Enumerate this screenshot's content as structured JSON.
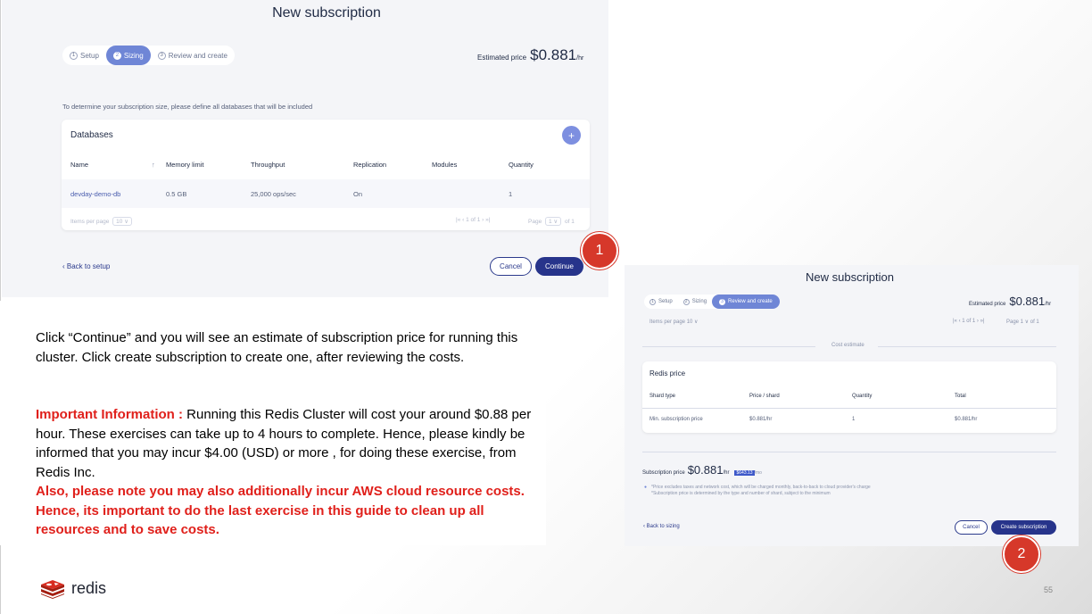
{
  "shot1": {
    "title": "New subscription",
    "steps": [
      {
        "num": "1",
        "label": "Setup"
      },
      {
        "num": "2",
        "label": "Sizing"
      },
      {
        "num": "3",
        "label": "Review and create"
      }
    ],
    "estimated_label": "Estimated price",
    "estimated_value": "$0.881",
    "estimated_unit": "/hr",
    "hint": "To determine your subscription size, please define all databases that will be included",
    "card_title": "Databases",
    "plus": "+",
    "columns": [
      "Name",
      "Memory limit",
      "Throughput",
      "Replication",
      "Modules",
      "Quantity"
    ],
    "sort_arrow": "↑",
    "row": {
      "name": "devday-demo-db",
      "memory": "0.5 GB",
      "throughput": "25,000 ops/sec",
      "replication": "On",
      "modules": "",
      "quantity": "1"
    },
    "items_per_page_label": "Items per page",
    "items_per_page_value": "10 ∨",
    "pagination": "|«  ‹  1 of 1  ›  »|",
    "page_label": "Page",
    "page_value": "1  ∨",
    "page_of": "of 1",
    "back_link": "‹ Back to setup",
    "cancel": "Cancel",
    "continue": "Continue"
  },
  "callouts": {
    "one": "1",
    "two": "2"
  },
  "shot2": {
    "title": "New subscription",
    "steps": [
      {
        "num": "1",
        "label": "Setup"
      },
      {
        "num": "2",
        "label": "Sizing"
      },
      {
        "num": "3",
        "label": "Review and create"
      }
    ],
    "estimated_label": "Estimated price",
    "estimated_value": "$0.881",
    "estimated_unit": "/hr",
    "items_per_page": "Items per page  10 ∨",
    "pagination": "|«  ‹  1 of 1  ›  »|",
    "page": "Page  1  ∨  of 1",
    "cost_estimate": "Cost estimate",
    "card_title": "Redis price",
    "columns": [
      "Shard type",
      "Price / shard",
      "Quantity",
      "Total"
    ],
    "row": {
      "type": "Min. subscription price",
      "price": "$0.881/hr",
      "qty": "1",
      "total": "$0.881/hr"
    },
    "sub_label": "Subscription price",
    "sub_value": "$0.881",
    "sub_unit": "/hr",
    "sub_highlight": "$643.13",
    "sub_tail": "/mo",
    "note1": "*Price excludes taxes and network cost, which will be charged monthly, back-to-back to cloud provider's charge",
    "note2": "*Subscription price is determined by the type and number of shard, subject to the minimum",
    "back_link": "‹ Back to sizing",
    "cancel": "Cancel",
    "create": "Create subscription"
  },
  "text": {
    "para1": "Click “Continue” and you will see an estimate of subscription price for running this cluster.  Click create subscription to create one, after reviewing the costs.",
    "important_label": "Important Information :",
    "important_body": " Running this Redis Cluster will cost your around $0.88 per hour. These exercises can take up to 4 hours to complete. Hence, please kindly be informed that you may incur $4.00 (USD)  or more , for doing these exercise, from Redis Inc.",
    "also": "Also, please note  you may also additionally incur AWS cloud resource costs. Hence, its important to do the last exercise in this guide to clean up all resources and to save costs."
  },
  "logo_text": "redis",
  "page_number": "55"
}
